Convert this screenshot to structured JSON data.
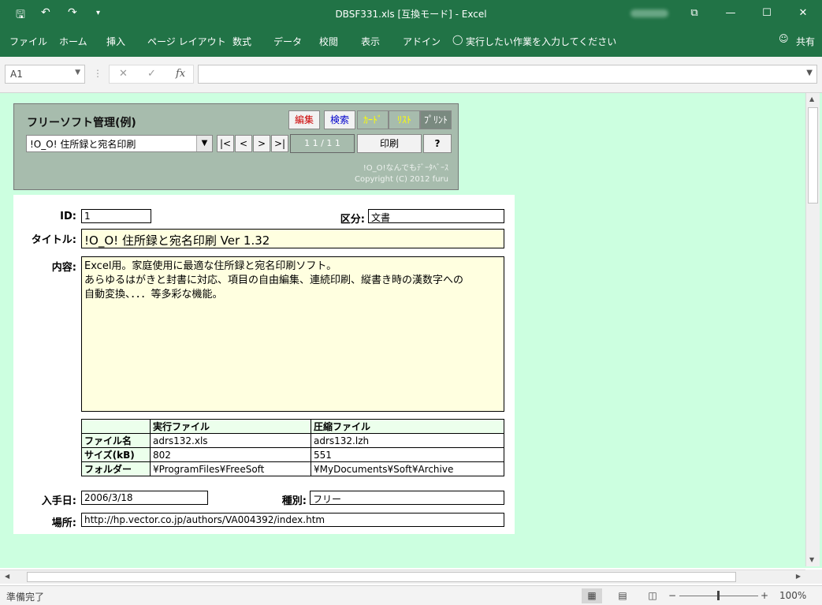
{
  "window": {
    "title": "DBSF331.xls  [互換モード] - Excel",
    "quick_access": {
      "save": "🖫",
      "undo": "↶",
      "redo": "↷",
      "customize": "▾"
    },
    "controls": {
      "ribbon_display": "⧉",
      "minimize": "—",
      "maximize": "☐",
      "close": "✕"
    }
  },
  "ribbon": {
    "tabs": [
      "ファイル",
      "ホーム",
      "挿入",
      "ページ レイアウト",
      "数式",
      "データ",
      "校閲",
      "表示",
      "アドイン"
    ],
    "tell_me": "実行したい作業を入力してください",
    "share": "共有"
  },
  "formula_bar": {
    "name_box": "A1",
    "cancel": "✕",
    "enter": "✓",
    "fx": "fx",
    "value": ""
  },
  "panel": {
    "title": "フリーソフト管理(例)",
    "buttons": {
      "edit": "編集",
      "search": "検索",
      "card": "ｶｰﾄﾞ",
      "list": "ﾘｽﾄ",
      "print_tab": "ﾌﾟﾘﾝﾄ",
      "print": "印刷",
      "help": "?"
    },
    "combo_value": "!O_O! 住所録と宛名印刷",
    "nav": {
      "first": "|<",
      "prev": "<",
      "next": ">",
      "last": ">|"
    },
    "pager": "1 1 / 1 1",
    "copyright_1": "!O_O!なんでもﾃﾞｰﾀﾍﾞｰｽ",
    "copyright_2": "Copyright (C) 2012 furu"
  },
  "form": {
    "labels": {
      "id": "ID:",
      "category": "区分:",
      "title": "タイトル:",
      "content": "内容:",
      "acquired": "入手日:",
      "type": "種別:",
      "location": "場所:"
    },
    "id": "1",
    "category": "文書",
    "title": "!O_O! 住所録と宛名印刷  Ver 1.32",
    "content_lines": [
      "Excel用。家庭使用に最適な住所録と宛名印刷ソフト。",
      "あらゆるはがきと封書に対応、項目の自由編集、連続印刷、縦書き時の漢数字への",
      "自動変換、．．．等多彩な機能。"
    ],
    "file_table": {
      "headers": [
        "",
        "実行ファイル",
        "圧縮ファイル"
      ],
      "rows": [
        [
          "ファイル名",
          "adrs132.xls",
          "adrs132.lzh"
        ],
        [
          "サイズ(kB)",
          "802",
          "551"
        ],
        [
          "フォルダー",
          "¥ProgramFiles¥FreeSoft",
          "¥MyDocuments¥Soft¥Archive"
        ]
      ]
    },
    "acquired": "2006/3/18",
    "type": "フリー",
    "location": "http://hp.vector.co.jp/authors/VA004392/index.htm"
  },
  "status_bar": {
    "status": "準備完了",
    "zoom_minus": "−",
    "zoom_plus": "+",
    "zoom": "100%",
    "zoom_level": 1.0
  },
  "colors": {
    "excel_green": "#217346",
    "sheet_background": "#ccffe0",
    "panel": "#a7bcad",
    "field_yellow": "#ffffe0"
  }
}
